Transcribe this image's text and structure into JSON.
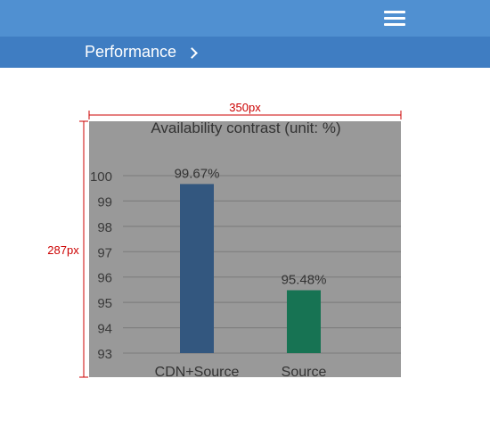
{
  "header": {
    "menu_icon": "hamburger-menu-icon"
  },
  "breadcrumb": {
    "label": "Performance",
    "separator_icon": "chevron-right-icon"
  },
  "annotations": {
    "width_label": "350px",
    "height_label": "287px",
    "color": "#cc0000"
  },
  "colors": {
    "topbar": "#5090d1",
    "navbar": "#3f7dc2",
    "chart_bg": "#999999"
  },
  "chart_data": {
    "type": "bar",
    "title": "Availability contrast (unit: %)",
    "categories": [
      "CDN+Source",
      "Source"
    ],
    "values": [
      99.67,
      95.48
    ],
    "value_labels": [
      "99.67%",
      "95.48%"
    ],
    "colors": [
      "#33577f",
      "#177353"
    ],
    "yticks": [
      93,
      94,
      95,
      96,
      97,
      98,
      99,
      100
    ],
    "ylim": [
      93,
      100
    ],
    "grid": true,
    "legend": "none"
  }
}
